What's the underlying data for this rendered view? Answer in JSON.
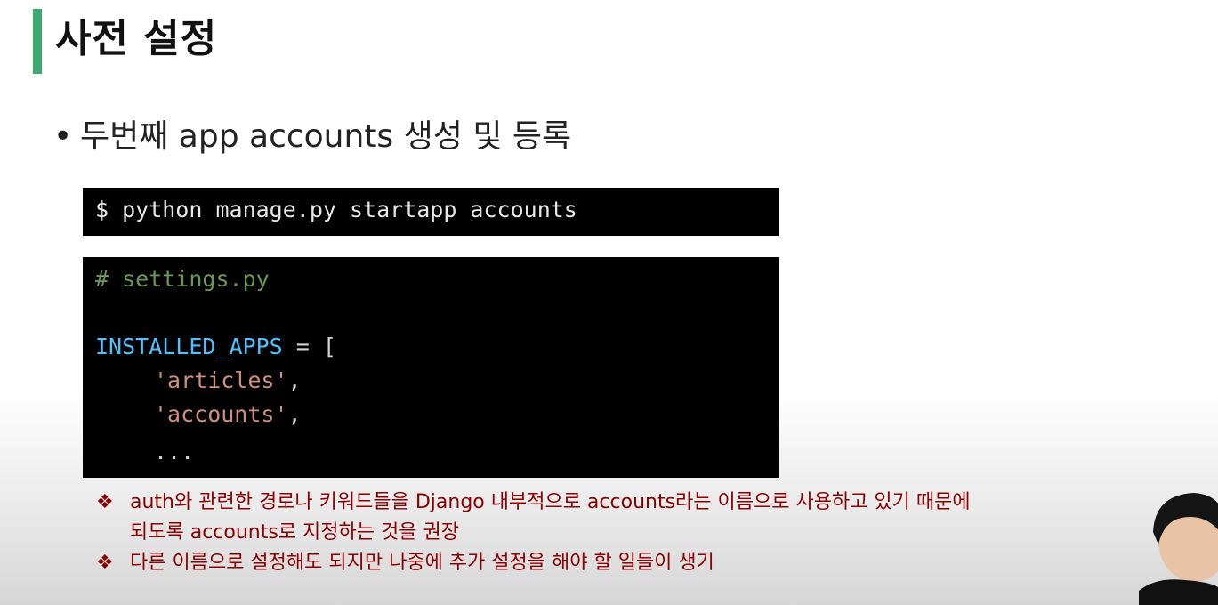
{
  "slide": {
    "title": "사전 설정",
    "bullet_text": "두번째 app accounts 생성 및 등록",
    "command": "$ python manage.py startapp accounts",
    "settings_code": {
      "comment": "# settings.py",
      "installed_apps_name": "INSTALLED_APPS",
      "assign": " = [",
      "item1": "'articles'",
      "item2": "'accounts'",
      "comma": ",",
      "ellipsis": "..."
    },
    "notes": [
      {
        "mark": "❖",
        "line1": "auth와 관련한 경로나 키워드들을 Django 내부적으로 accounts라는 이름으로 사용하고 있기 때문에",
        "line2": "되도록 accounts로 지정하는 것을 권장"
      },
      {
        "mark": "❖",
        "line1": "다른 이름으로 설정해도 되지만 나중에 추가 설정을 해야 할 일들이 생기"
      }
    ],
    "colors": {
      "title_accent": "#3aaa6f",
      "note_text": "#8b0000",
      "code_background": "#000000"
    }
  }
}
